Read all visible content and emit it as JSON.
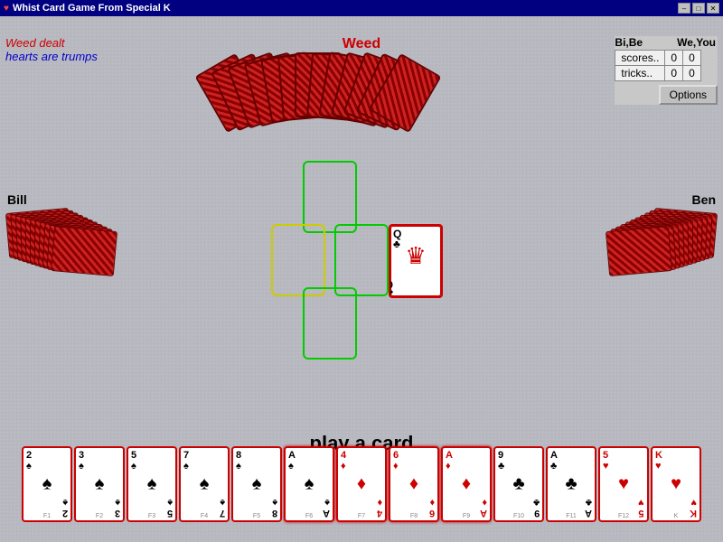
{
  "titleBar": {
    "icon": "♥",
    "title": "Whist Card Game From Special K",
    "btnMin": "–",
    "btnMax": "□",
    "btnClose": "✕"
  },
  "infoText": {
    "weedDealt": "Weed dealt",
    "heartsTrumps": "hearts are trumps"
  },
  "scorePanel": {
    "headerBiYou": "Bi,Be",
    "headerWeYou": "We,You",
    "scoresLabel": "scores..",
    "tricksLabel": "tricks..",
    "biBeScore": "0",
    "weYouScore": "0",
    "biBeTricks": "0",
    "weYouTricks": "0",
    "optionsLabel": "Options"
  },
  "players": {
    "weed": "Weed",
    "bill": "Bill",
    "ben": "Ben"
  },
  "playText": "play a card",
  "playArea": {
    "slots": [
      "top",
      "left",
      "right",
      "bottom"
    ]
  },
  "queenCard": {
    "rank": "Q",
    "suit": "♣",
    "color": "black",
    "label": "Queen of Clubs"
  },
  "playerHand": [
    {
      "rank": "2",
      "suit": "♠",
      "color": "black",
      "fn": "F1"
    },
    {
      "rank": "3",
      "suit": "♠",
      "color": "black",
      "fn": "F2"
    },
    {
      "rank": "5",
      "suit": "♠",
      "color": "black",
      "fn": "F3"
    },
    {
      "rank": "7",
      "suit": "♠",
      "color": "black",
      "fn": "F4"
    },
    {
      "rank": "8",
      "suit": "♠",
      "color": "black",
      "fn": "F5"
    },
    {
      "rank": "A",
      "suit": "♠",
      "color": "black",
      "fn": "F6",
      "highlight": true
    },
    {
      "rank": "4",
      "suit": "♦",
      "color": "red",
      "fn": "F7",
      "highlight": true
    },
    {
      "rank": "6",
      "suit": "♦",
      "color": "red",
      "fn": "F8",
      "highlight": true
    },
    {
      "rank": "A",
      "suit": "♦",
      "color": "red",
      "fn": "F9",
      "highlight": true
    },
    {
      "rank": "9",
      "suit": "♣",
      "color": "black",
      "fn": "F10"
    },
    {
      "rank": "A",
      "suit": "♣",
      "color": "black",
      "fn": "F11"
    },
    {
      "rank": "5",
      "suit": "♥",
      "color": "red",
      "fn": "F12"
    },
    {
      "rank": "K",
      "suit": "♥",
      "color": "red",
      "fn": "K"
    }
  ]
}
